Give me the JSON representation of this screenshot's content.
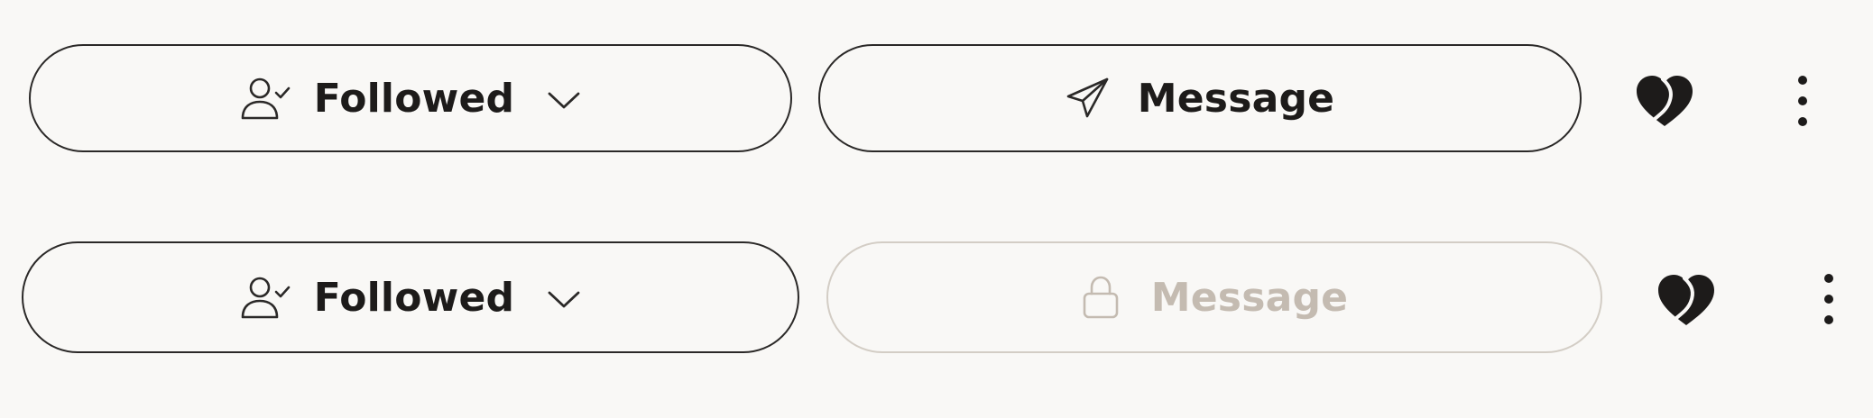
{
  "rows": [
    {
      "followed_button": {
        "label": "Followed",
        "icons": [
          "user-check-icon",
          "chevron-down-icon"
        ]
      },
      "message_button": {
        "label": "Message",
        "state": "enabled",
        "icon": "send-icon"
      },
      "heart_icon": "broken-heart-icon",
      "more_icon": "more-vertical-icon"
    },
    {
      "followed_button": {
        "label": "Followed",
        "icons": [
          "user-check-icon",
          "chevron-down-icon"
        ]
      },
      "message_button": {
        "label": "Message",
        "state": "locked",
        "icon": "lock-icon"
      },
      "heart_icon": "broken-heart-icon",
      "more_icon": "more-vertical-icon"
    }
  ],
  "colors": {
    "background": "#f9f8f6",
    "text": "#1d1b1a",
    "border": "#2b2928",
    "disabled_text": "#c4bbb1",
    "disabled_border": "#d3cdc5"
  }
}
